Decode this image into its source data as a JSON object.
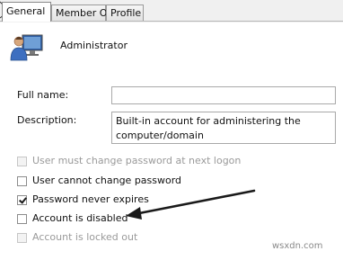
{
  "tabs": [
    {
      "label": "General",
      "active": true
    },
    {
      "label": "Member Of",
      "active": false
    },
    {
      "label": "Profile",
      "active": false
    }
  ],
  "user": {
    "name": "Administrator",
    "icon": "user-icon"
  },
  "fields": {
    "full_name": {
      "label": "Full name:",
      "value": ""
    },
    "description": {
      "label": "Description:",
      "value": "Built-in account for administering the computer/domain"
    }
  },
  "options": [
    {
      "label": "User must change password at next logon",
      "checked": false,
      "enabled": false
    },
    {
      "label": "User cannot change password",
      "checked": false,
      "enabled": true
    },
    {
      "label": "Password never expires",
      "checked": true,
      "enabled": true
    },
    {
      "label": "Account is disabled",
      "checked": false,
      "enabled": true
    },
    {
      "label": "Account is locked out",
      "checked": false,
      "enabled": false
    }
  ],
  "watermark": "wsxdn.com",
  "colors": {
    "annotation_arrow": "#1a1a1a",
    "disabled_text": "#9a9a9a"
  }
}
